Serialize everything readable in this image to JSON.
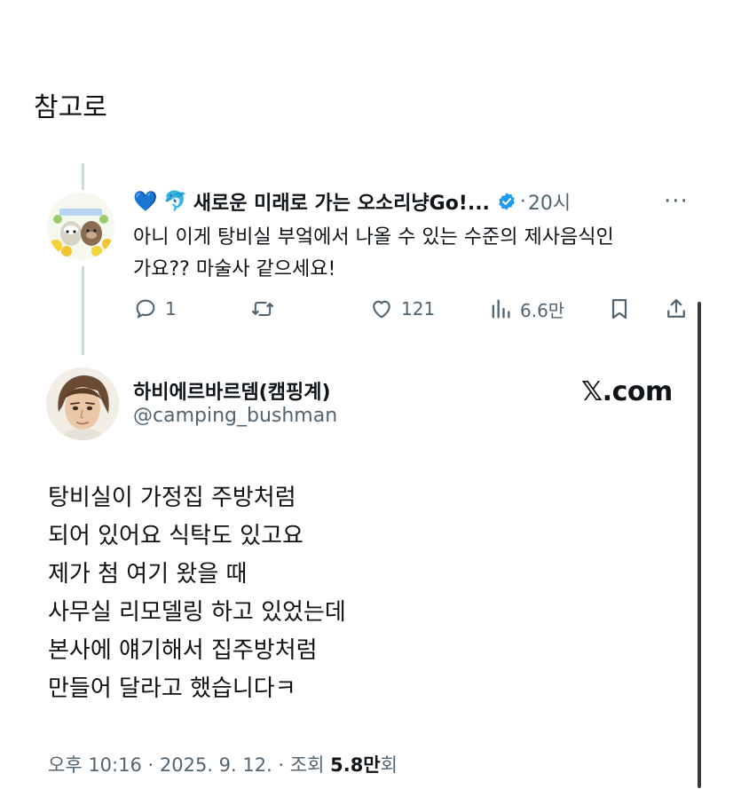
{
  "intro_text": "참고로",
  "reply": {
    "emojis": "💙 🐬",
    "name": "새로운 미래로 가는 오소리냥Go!...",
    "separator": "·",
    "time": "20시",
    "more": "···",
    "text_lines": [
      "아니 이게 탕비실 부엌에서 나올 수 있는 수준의 제사음식인",
      "가요?? 마술사 같으세요!"
    ],
    "actions": {
      "replies": "1",
      "retweets": "",
      "likes": "121",
      "views": "6.6만"
    },
    "icons": [
      "reply-icon",
      "retweet-icon",
      "like-icon",
      "views-icon",
      "bookmark-icon",
      "share-icon"
    ]
  },
  "main": {
    "name": "하비에르바르뎀(캠핑계)",
    "handle": "@camping_bushman",
    "brand": "𝕏.com",
    "text_lines": [
      "탕비실이 가정집 주방처럼",
      "되어 있어요 식탁도 있고요",
      "제가 첨 여기 왔을 때",
      "사무실 리모델링 하고 있었는데",
      "본사에 얘기해서 집주방처럼",
      "만들어 달라고 했습니다ㅋ"
    ],
    "meta_prefix": "오후 10:16 · 2025. 9. 12. · 조회 ",
    "meta_views": "5.8만",
    "meta_suffix": "회"
  },
  "colors": {
    "verified": "#1d9bf0",
    "muted": "#536471",
    "text": "#0f1419"
  }
}
